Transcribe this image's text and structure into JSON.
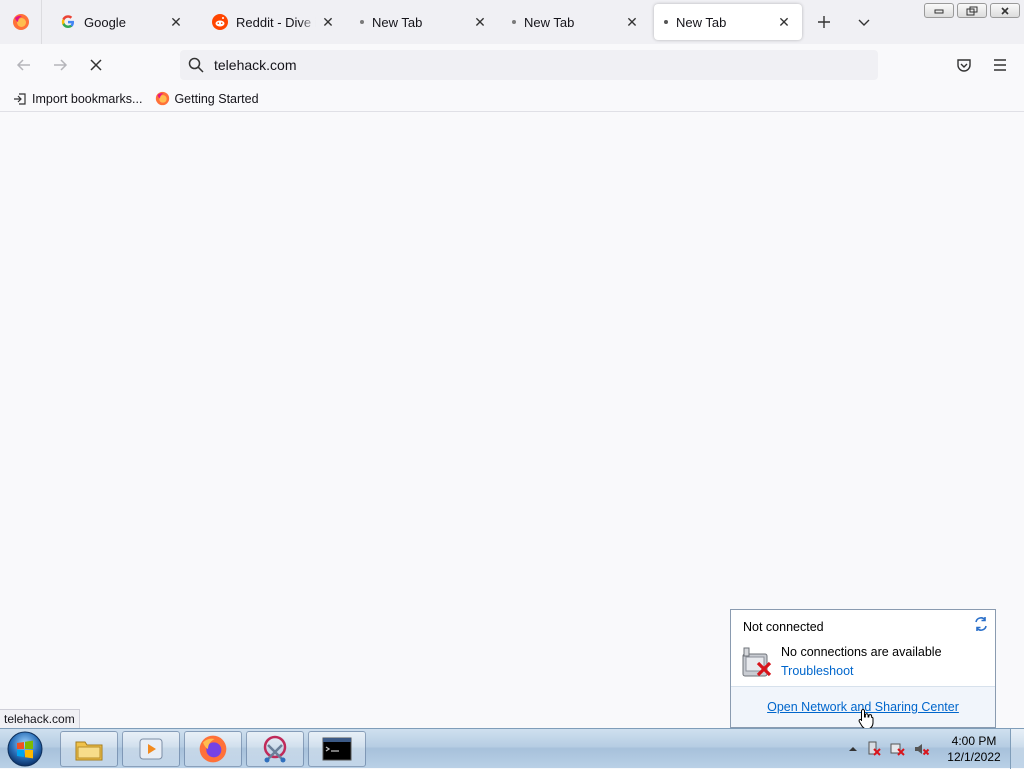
{
  "browser": {
    "tabs": [
      {
        "title": "Google",
        "favicon": "google-icon",
        "active": false
      },
      {
        "title": "Reddit - Dive into anything",
        "favicon": "reddit-icon",
        "active": false
      },
      {
        "title": "New Tab",
        "favicon": "loading-dot",
        "active": false
      },
      {
        "title": "New Tab",
        "favicon": "loading-dot",
        "active": false
      },
      {
        "title": "New Tab",
        "favicon": "loading-dot",
        "active": true
      }
    ],
    "url": "telehack.com",
    "bookmarks": [
      {
        "label": "Import bookmarks...",
        "icon": "import-icon"
      },
      {
        "label": "Getting Started",
        "icon": "firefox-icon"
      }
    ],
    "status_url": "telehack.com"
  },
  "network_popup": {
    "title": "Not connected",
    "message": "No connections are available",
    "troubleshoot": "Troubleshoot",
    "footer_link": "Open Network and Sharing Center"
  },
  "taskbar": {
    "time": "4:00 PM",
    "date": "12/1/2022",
    "items": [
      "file-explorer-icon",
      "media-player-icon",
      "firefox-icon",
      "snipping-tool-icon",
      "command-prompt-icon"
    ]
  },
  "colors": {
    "link": "#0066cc",
    "tab_strip": "#f0f0f4",
    "content_bg": "#f9f9fb"
  }
}
